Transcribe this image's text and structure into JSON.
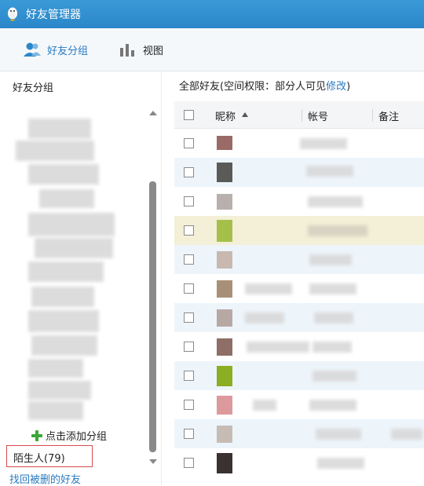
{
  "window": {
    "title": "好友管理器"
  },
  "toolbar": {
    "tab_friend_groups": "好友分组",
    "tab_view": "视图"
  },
  "sidebar": {
    "title": "好友分组",
    "add_group": "点击添加分组",
    "stranger": "陌生人(79)",
    "recover": "找回被删的好友"
  },
  "main": {
    "title_prefix": "全部好友(空间权限：部分人可见",
    "title_link": "修改",
    "title_suffix": ")"
  },
  "table": {
    "columns": [
      "昵称",
      "帐号",
      "备注"
    ],
    "sort": {
      "column": "昵称",
      "direction": "asc",
      "icon": "sort-up-icon"
    },
    "row_count": 12,
    "selected_row": 4
  },
  "colors": {
    "titlebar": "#2a86c8",
    "accent": "#2a7ac0",
    "stranger_border": "#d84c4c",
    "row_alt": "#edf5fb",
    "row_selected": "#f4efd7",
    "add_icon": "#3aa838"
  }
}
